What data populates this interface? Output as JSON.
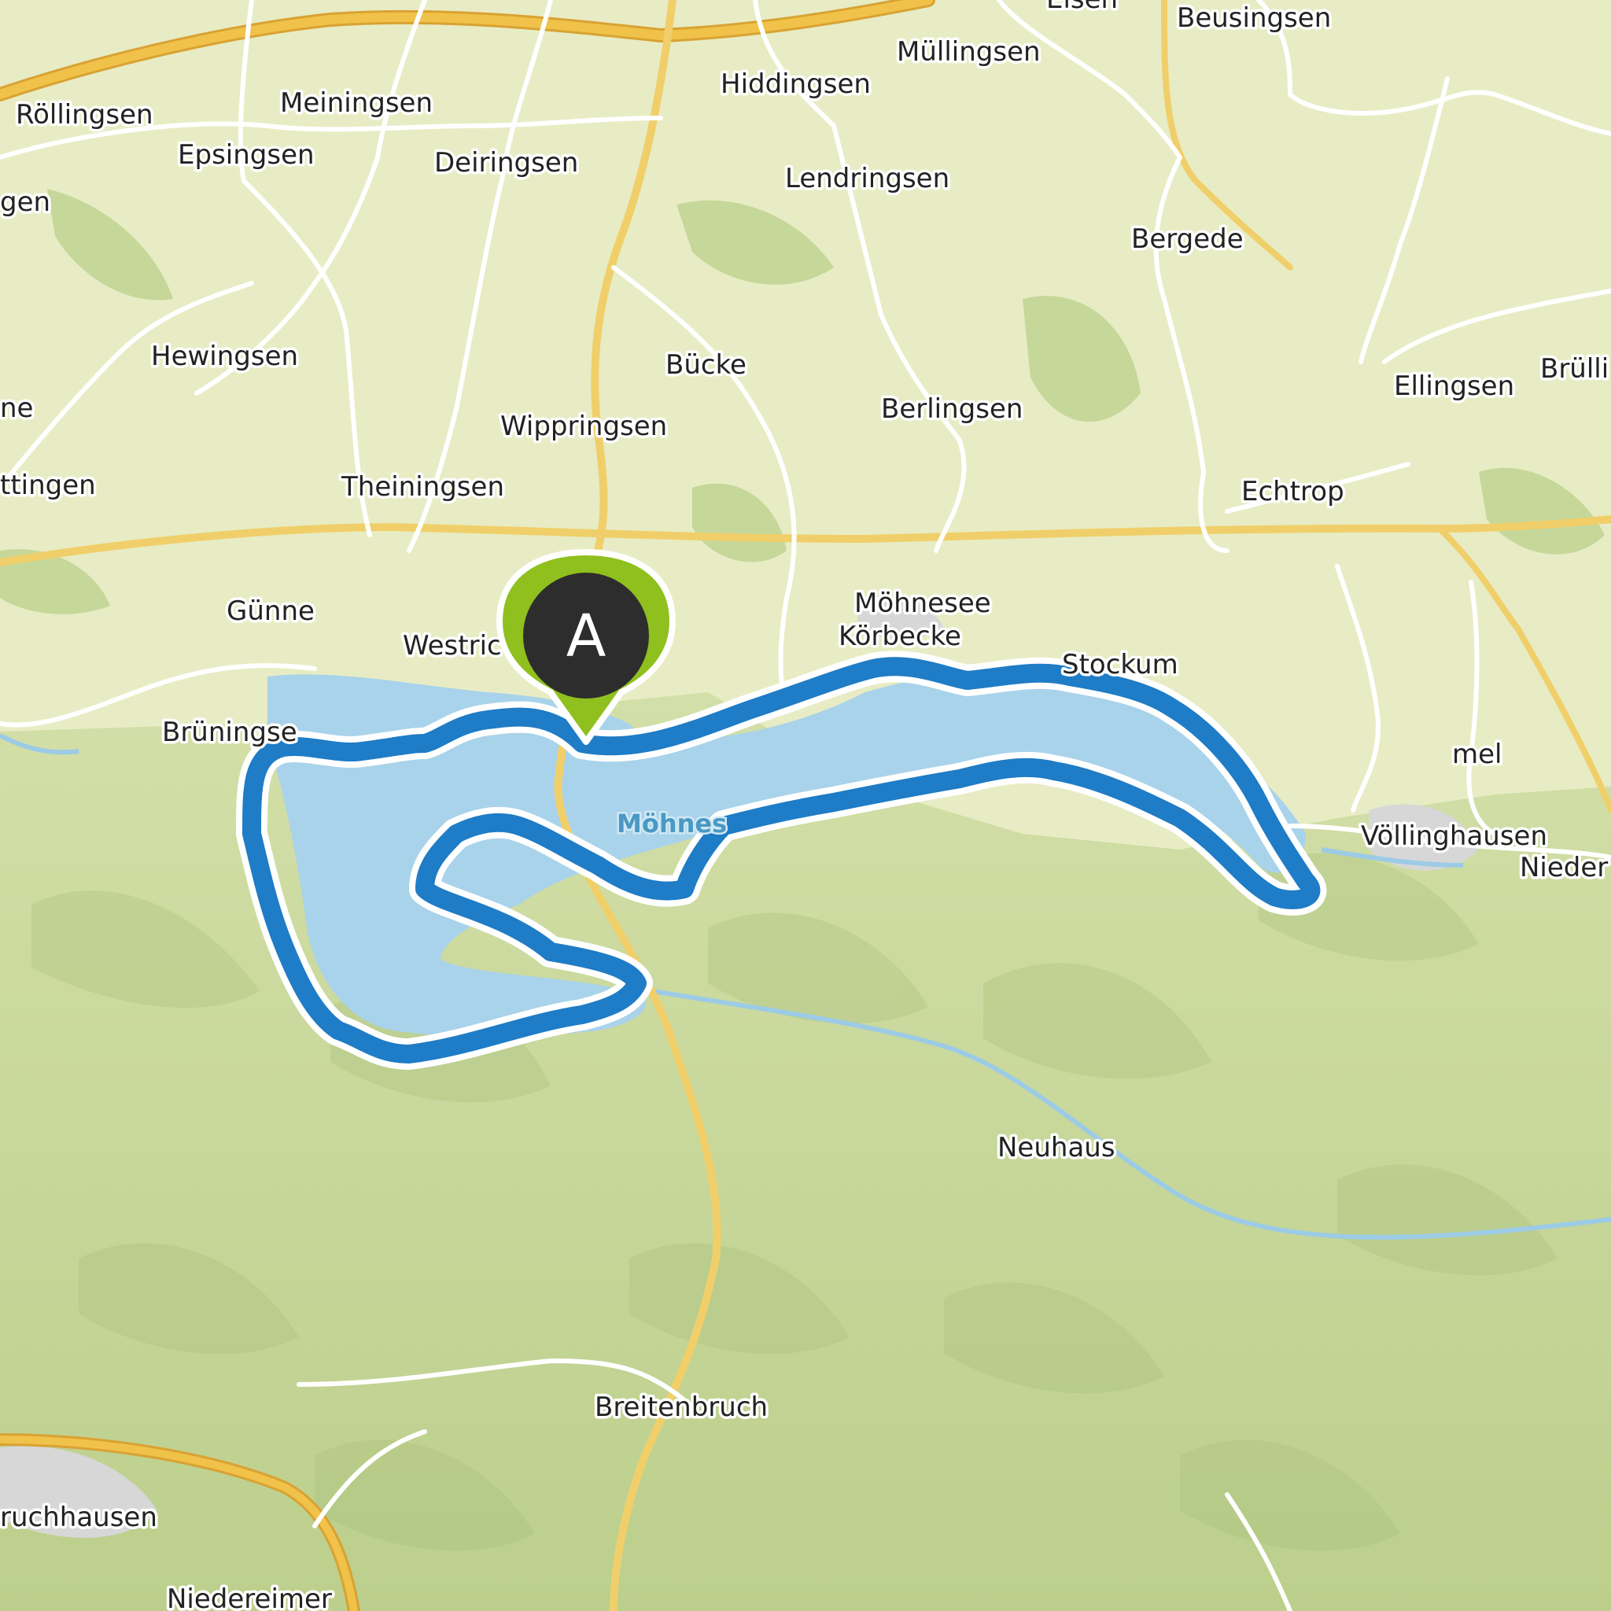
{
  "map": {
    "colors": {
      "land": "#e8ecc4",
      "forest": "#c6d79a",
      "water": "#a9d3ea",
      "route": "#1f7cc6",
      "route_casing": "#ffffff",
      "major_road": "#f0c24a",
      "minor_road": "#ffffff",
      "marker_fill": "#2d2d2d",
      "marker_ring": "#8fc01e"
    },
    "places": {
      "beusingsen": "Beusingsen",
      "elsen": "Elsen",
      "muellingsen": "Müllingsen",
      "hiddingsen": "Hiddingsen",
      "meiningsen": "Meiningsen",
      "roellingsen": "Röllingsen",
      "epsingsen": "Epsingsen",
      "deiringsen": "Deiringsen",
      "gen": "gen",
      "lendringsen": "Lendringsen",
      "bergede": "Bergede",
      "hewingsen": "Hewingsen",
      "buecke": "Bücke",
      "berlingsen": "Berlingsen",
      "ellingsen": "Ellingsen",
      "bruelli": "Brülli",
      "ne": "ne",
      "wippringsen": "Wippringsen",
      "ttingen": "ttingen",
      "theiningsen": "Theiningsen",
      "echtrop": "Echtrop",
      "guenne": "Günne",
      "moehnesee": "Möhnesee",
      "koerbecke": "Körbecke",
      "westric": "Westric",
      "stockum": "Stockum",
      "brueningse": "Brüningse",
      "mel": "mel",
      "voellinghausen": "Völlinghausen",
      "nieder": "Nieder",
      "neuhaus": "Neuhaus",
      "breitenbruch": "Breitenbruch",
      "ruchhausen": "ruchhausen",
      "niedereimer": "Niedereimer"
    },
    "lake_label": "Möhnes",
    "marker": {
      "letter": "A",
      "icon": "map-pin-icon"
    }
  }
}
